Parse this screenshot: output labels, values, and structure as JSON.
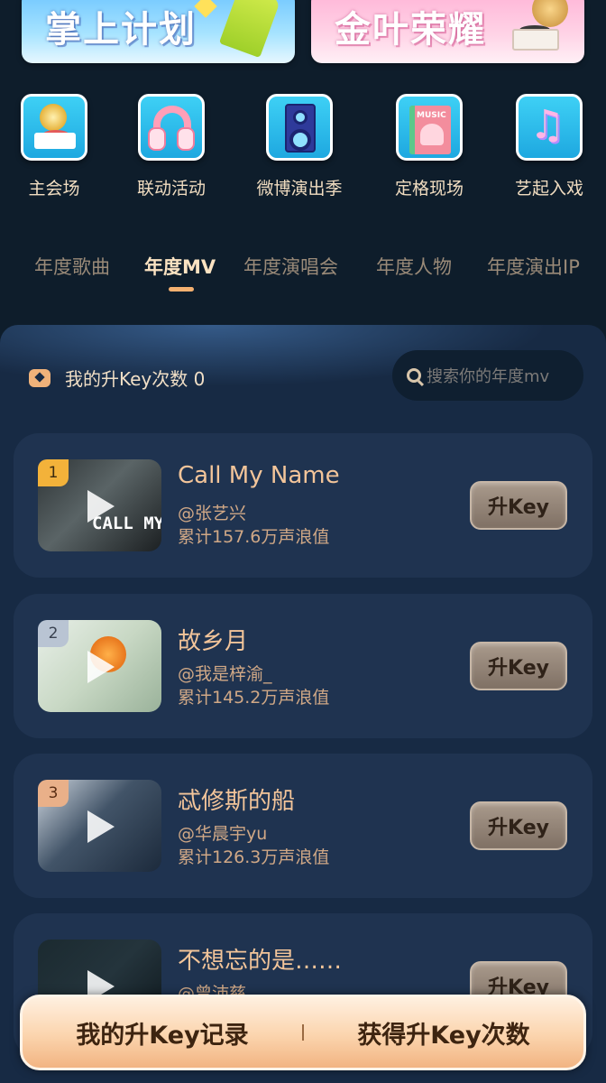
{
  "banners": [
    {
      "text": "掌上计划"
    },
    {
      "text": "金叶荣耀"
    }
  ],
  "categories": [
    {
      "label": "主会场",
      "icon": "gramophone-icon"
    },
    {
      "label": "联动活动",
      "icon": "headphones-icon"
    },
    {
      "label": "微博演出季",
      "icon": "speaker-icon"
    },
    {
      "label": "定格现场",
      "icon": "music-book-icon"
    },
    {
      "label": "艺起入戏",
      "icon": "music-note-icon"
    }
  ],
  "tabs": [
    {
      "label": "年度歌曲",
      "active": false
    },
    {
      "label": "年度MV",
      "active": true
    },
    {
      "label": "年度演唱会",
      "active": false
    },
    {
      "label": "年度人物",
      "active": false
    },
    {
      "label": "年度演出IP",
      "active": false
    }
  ],
  "panel": {
    "key_count_text": "我的升Key次数 0",
    "search_placeholder": "搜索你的年度mv"
  },
  "items": [
    {
      "rank": "1",
      "title": "Call My Name",
      "artist": "@张艺兴",
      "total": "累计157.6万声浪值",
      "button": "升Key",
      "thumb_caption": "CALL MY NAI"
    },
    {
      "rank": "2",
      "title": "故乡月",
      "artist": "@我是梓渝_",
      "total": "累计145.2万声浪值",
      "button": "升Key",
      "thumb_caption": ""
    },
    {
      "rank": "3",
      "title": "忒修斯的船",
      "artist": "@华晨宇yu",
      "total": "累计126.3万声浪值",
      "button": "升Key",
      "thumb_caption": ""
    },
    {
      "rank": "",
      "title": "不想忘的是……",
      "artist": "@曾沛慈",
      "total": "",
      "button": "升Key",
      "thumb_caption": ""
    }
  ],
  "bottom": {
    "left": "我的升Key记录",
    "right": "获得升Key次数"
  },
  "colors": {
    "background": "#0e1d2b",
    "panel": "#172a44",
    "card": "#1f3350",
    "accent": "#f4b070",
    "rank_gold": "#f3b23a",
    "rank_silver": "#b9c4d3",
    "rank_bronze": "#e9b089"
  }
}
